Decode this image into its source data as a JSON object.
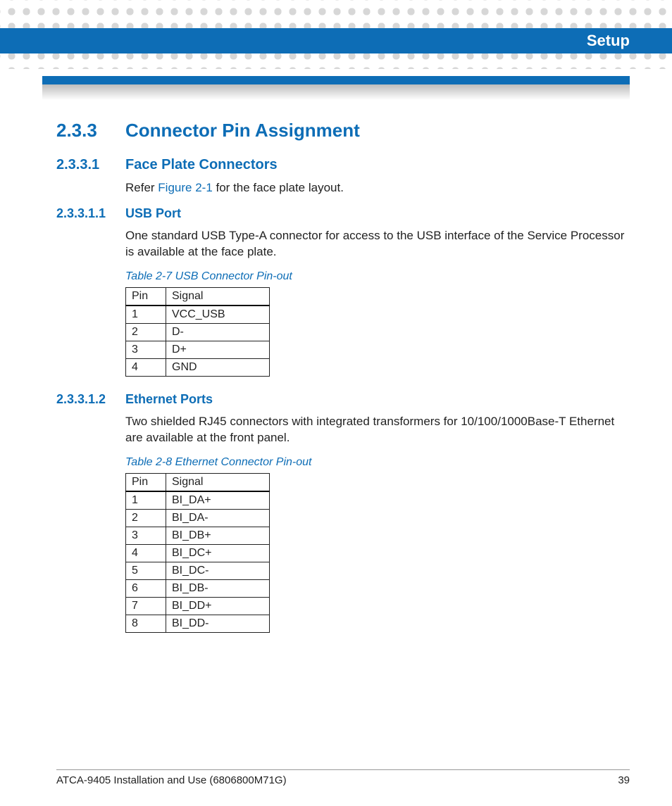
{
  "header": {
    "chapter": "Setup"
  },
  "section_233": {
    "num": "2.3.3",
    "title": "Connector Pin Assignment"
  },
  "section_2331": {
    "num": "2.3.3.1",
    "title": "Face Plate Connectors",
    "body_pre": "Refer ",
    "body_link": "Figure 2-1",
    "body_post": " for the face plate layout."
  },
  "section_23311": {
    "num": "2.3.3.1.1",
    "title": "USB Port",
    "body": "One standard USB Type-A connector for access to the USB interface of the Service Processor is available at the face plate."
  },
  "table_usb": {
    "caption": "Table 2-7 USB Connector Pin-out",
    "head_pin": "Pin",
    "head_signal": "Signal",
    "rows": [
      {
        "pin": "1",
        "signal": "VCC_USB"
      },
      {
        "pin": "2",
        "signal": "D-"
      },
      {
        "pin": "3",
        "signal": "D+"
      },
      {
        "pin": "4",
        "signal": "GND"
      }
    ]
  },
  "section_23312": {
    "num": "2.3.3.1.2",
    "title": "Ethernet Ports",
    "body": "Two shielded RJ45 connectors with integrated transformers for 10/100/1000Base-T Ethernet are available at the front panel."
  },
  "table_eth": {
    "caption": "Table 2-8 Ethernet Connector Pin-out",
    "head_pin": "Pin",
    "head_signal": "Signal",
    "rows": [
      {
        "pin": "1",
        "signal": "BI_DA+"
      },
      {
        "pin": "2",
        "signal": "BI_DA-"
      },
      {
        "pin": "3",
        "signal": "BI_DB+"
      },
      {
        "pin": "4",
        "signal": "BI_DC+"
      },
      {
        "pin": "5",
        "signal": "BI_DC-"
      },
      {
        "pin": "6",
        "signal": "BI_DB-"
      },
      {
        "pin": "7",
        "signal": "BI_DD+"
      },
      {
        "pin": "8",
        "signal": "BI_DD-"
      }
    ]
  },
  "footer": {
    "doc": "ATCA-9405 Installation and Use (6806800M71G)",
    "page": "39"
  }
}
